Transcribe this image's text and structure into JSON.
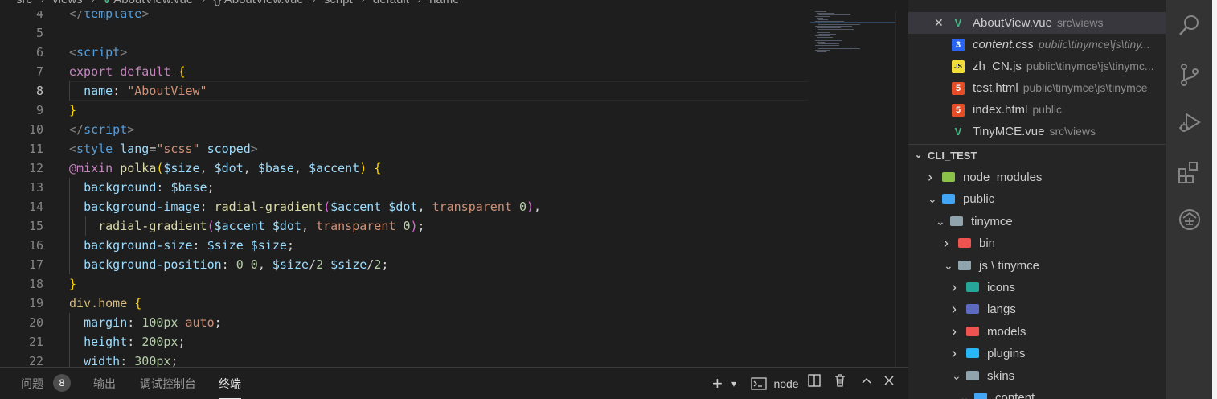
{
  "breadcrumb": [
    "src",
    "views",
    "AboutView.vue",
    "{} AboutView.vue",
    "script",
    "default",
    "name"
  ],
  "editor": {
    "lines": [
      {
        "n": "4",
        "html": "<span class='tag'>&lt;/</span><span class='tn'>template</span><span class='tag'>&gt;</span>"
      },
      {
        "n": "5",
        "html": ""
      },
      {
        "n": "6",
        "html": "<span class='tag'>&lt;</span><span class='tn'>script</span><span class='tag'>&gt;</span>"
      },
      {
        "n": "7",
        "html": "<span class='kw'>export</span> <span class='kw'>default</span> <span class='br'>{</span>"
      },
      {
        "n": "8",
        "html": "  <span class='pn'>name</span><span class='pl'>: </span><span class='st'>\"AboutView\"</span>"
      },
      {
        "n": "9",
        "html": "<span class='br'>}</span>"
      },
      {
        "n": "10",
        "html": "<span class='tag'>&lt;/</span><span class='tn'>script</span><span class='tag'>&gt;</span>"
      },
      {
        "n": "11",
        "html": "<span class='tag'>&lt;</span><span class='tn'>style</span> <span class='pn'>lang</span><span class='pl'>=</span><span class='st'>\"scss\"</span> <span class='pn'>scoped</span><span class='tag'>&gt;</span>"
      },
      {
        "n": "12",
        "html": "<span class='kw'>@mixin</span> <span class='fn'>polka</span><span class='br'>(</span><span class='vr'>$size</span><span class='pl'>, </span><span class='vr'>$dot</span><span class='pl'>, </span><span class='vr'>$base</span><span class='pl'>, </span><span class='vr'>$accent</span><span class='br'>)</span> <span class='br'>{</span>"
      },
      {
        "n": "13",
        "html": "  <span class='pn'>background</span><span class='pl'>: </span><span class='vr'>$base</span><span class='pl'>;</span>"
      },
      {
        "n": "14",
        "html": "  <span class='pn'>background-image</span><span class='pl'>: </span><span class='fn'>radial-gradient</span><span class='br2'>(</span><span class='vr'>$accent</span> <span class='vr'>$dot</span><span class='pl'>, </span><span class='st'>transparent</span> <span class='num'>0</span><span class='br2'>)</span><span class='pl'>,</span>"
      },
      {
        "n": "15",
        "html": "    <span class='fn'>radial-gradient</span><span class='br2'>(</span><span class='vr'>$accent</span> <span class='vr'>$dot</span><span class='pl'>, </span><span class='st'>transparent</span> <span class='num'>0</span><span class='br2'>)</span><span class='pl'>;</span>"
      },
      {
        "n": "16",
        "html": "  <span class='pn'>background-size</span><span class='pl'>: </span><span class='vr'>$size</span> <span class='vr'>$size</span><span class='pl'>;</span>"
      },
      {
        "n": "17",
        "html": "  <span class='pn'>background-position</span><span class='pl'>: </span><span class='num'>0</span> <span class='num'>0</span><span class='pl'>, </span><span class='vr'>$size</span><span class='pl'>/</span><span class='num'>2</span> <span class='vr'>$size</span><span class='pl'>/</span><span class='num'>2</span><span class='pl'>;</span>"
      },
      {
        "n": "18",
        "html": "<span class='br'>}</span>"
      },
      {
        "n": "19",
        "html": "<span class='sel'>div.home</span> <span class='br'>{</span>"
      },
      {
        "n": "20",
        "html": "  <span class='pn'>margin</span><span class='pl'>: </span><span class='num'>100px</span> <span class='st'>auto</span><span class='pl'>;</span>"
      },
      {
        "n": "21",
        "html": "  <span class='pn'>height</span><span class='pl'>: </span><span class='num'>200px</span><span class='pl'>;</span>"
      },
      {
        "n": "22",
        "html": "  <span class='pn'>width</span><span class='pl'>: </span><span class='num'>300px</span><span class='pl'>;</span>"
      }
    ],
    "active_line": "8"
  },
  "panel": {
    "tabs": [
      {
        "label": "问题",
        "active": false
      },
      {
        "label": "输出",
        "active": false
      },
      {
        "label": "调试控制台",
        "active": false
      },
      {
        "label": "终端",
        "active": true
      }
    ],
    "problems_count": "8",
    "terminal_name": "node",
    "actions": {
      "add": "+",
      "dropdown": "⌄",
      "split": "split",
      "trash": "trash",
      "maximize": "^",
      "close": "✕"
    }
  },
  "sidebar": {
    "open_editors": [
      {
        "name": "AboutView.vue",
        "path": "src\\views",
        "type": "vue",
        "selected": true,
        "italic": false
      },
      {
        "name": "content.css",
        "path": "public\\tinymce\\js\\tiny...",
        "type": "css",
        "selected": false,
        "italic": true
      },
      {
        "name": "zh_CN.js",
        "path": "public\\tinymce\\js\\tinymc...",
        "type": "js",
        "selected": false,
        "italic": false
      },
      {
        "name": "test.html",
        "path": "public\\tinymce\\js\\tinymce",
        "type": "html",
        "selected": false,
        "italic": false
      },
      {
        "name": "index.html",
        "path": "public",
        "type": "html",
        "selected": false,
        "italic": false
      },
      {
        "name": "TinyMCE.vue",
        "path": "src\\views",
        "type": "vue",
        "selected": false,
        "italic": false
      }
    ],
    "section_title": "CLI_TEST",
    "tree": [
      {
        "name": "node_modules",
        "depth": 0,
        "open": false,
        "color": "#8bc34a"
      },
      {
        "name": "public",
        "depth": 0,
        "open": true,
        "color": "#42a5f5"
      },
      {
        "name": "tinymce",
        "depth": 1,
        "open": true,
        "color": "#90a4ae"
      },
      {
        "name": "bin",
        "depth": 2,
        "open": false,
        "color": "#ef5350"
      },
      {
        "name": "js \\ tinymce",
        "depth": 2,
        "open": true,
        "color": "#90a4ae"
      },
      {
        "name": "icons",
        "depth": 3,
        "open": false,
        "color": "#26a69a"
      },
      {
        "name": "langs",
        "depth": 3,
        "open": false,
        "color": "#5c6bc0"
      },
      {
        "name": "models",
        "depth": 3,
        "open": false,
        "color": "#ef5350"
      },
      {
        "name": "plugins",
        "depth": 3,
        "open": false,
        "color": "#29b6f6"
      },
      {
        "name": "skins",
        "depth": 3,
        "open": true,
        "color": "#90a4ae"
      },
      {
        "name": "content",
        "depth": 4,
        "open": true,
        "color": "#42a5f5"
      }
    ]
  },
  "activity_bar": [
    "search-icon",
    "source-control-icon",
    "run-debug-icon",
    "extensions-icon",
    "remote-icon"
  ],
  "colors": {
    "accent": "#007acc",
    "vue": "#41b883",
    "css": "#2965f1",
    "js": "#f1dd35",
    "html": "#e44d26"
  }
}
